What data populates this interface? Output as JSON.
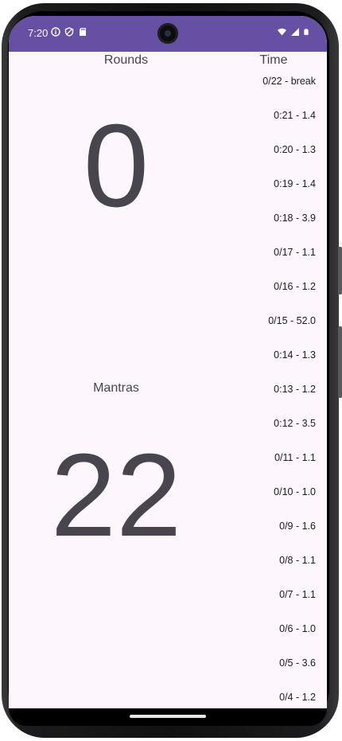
{
  "status_bar": {
    "time": "7:20",
    "background_color": "#6650a4",
    "left_icons": [
      "info-icon",
      "shield-icon",
      "sd-card-icon"
    ],
    "right_icons": [
      "wifi-icon",
      "signal-icon",
      "battery-icon"
    ]
  },
  "rounds": {
    "label": "Rounds",
    "value": "0"
  },
  "mantras": {
    "label": "Mantras",
    "value": "22"
  },
  "time_log": {
    "label": "Time",
    "entries": [
      "0/22 - break",
      "0:21 - 1.4",
      "0:20 - 1.3",
      "0:19 - 1.4",
      "0:18 - 3.9",
      "0/17 - 1.1",
      "0/16 - 1.2",
      "0/15 - 52.0",
      "0:14 - 1.3",
      "0:13 - 1.2",
      "0:12 - 3.5",
      "0/11 - 1.1",
      "0/10 - 1.0",
      "0/9 - 1.6",
      "0/8 - 1.1",
      "0/7 - 1.1",
      "0/6 - 1.0",
      "0/5 - 3.6",
      "0/4 - 1.2"
    ]
  },
  "colors": {
    "app_background": "#fdf6fc",
    "primary_text": "#49454f",
    "list_text": "#1d1b20"
  }
}
